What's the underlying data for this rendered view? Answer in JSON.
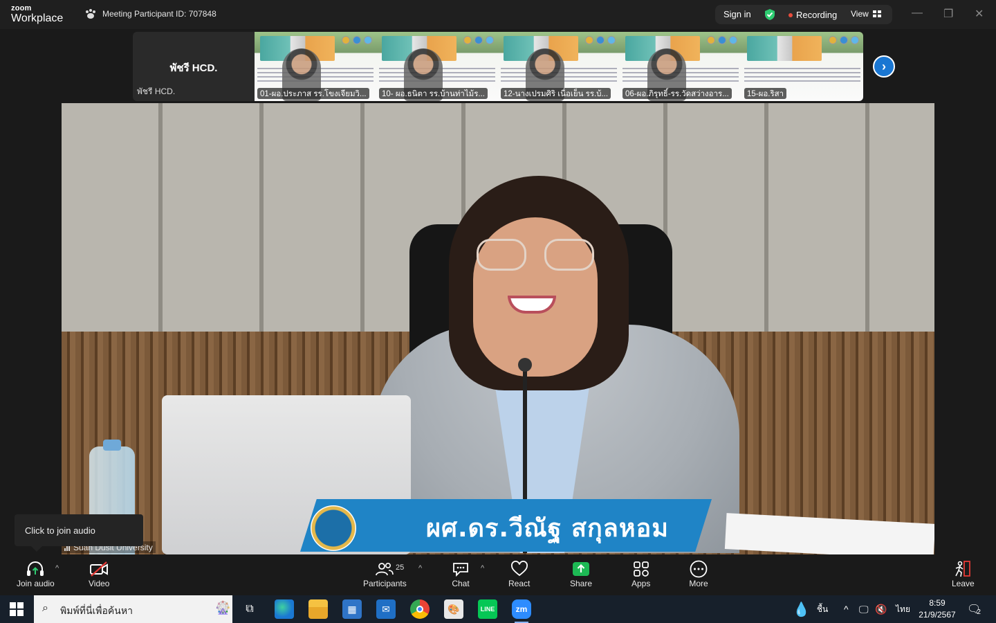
{
  "app": {
    "brand_small": "zoom",
    "brand_large": "Workplace"
  },
  "header": {
    "meeting_id": "Meeting Participant ID: 707848",
    "sign_in": "Sign in",
    "recording": "Recording",
    "view": "View"
  },
  "self_tile": {
    "big_name": "พัชรี HCD.",
    "small_name": "พัชรี HCD."
  },
  "thumbnails": [
    {
      "name": "01-ผอ.ประภาส รร.โขงเจียมวิ...",
      "muted": true
    },
    {
      "name": "10- ผอ.ธนิตา รร.บ้านท่าไม้ร...",
      "muted": true
    },
    {
      "name": "12-นางเปรมศิริ เนื่อเย็น รร.บ้...",
      "muted": true
    },
    {
      "name": "06-ผอ.ภิรุทธิ์-รร.วัดสว่างอาร...",
      "muted": true
    },
    {
      "name": "15-ผอ.ริสา",
      "muted": true
    }
  ],
  "main_video": {
    "name_banner": "ผศ.ดร.วีณัฐ สกุลหอม",
    "label": "Suan Dusit University"
  },
  "tooltip": "Click to join audio",
  "toolbar": {
    "join_audio": "Join audio",
    "video": "Video",
    "participants": "Participants",
    "participants_count": "25",
    "chat": "Chat",
    "react": "React",
    "share": "Share",
    "apps": "Apps",
    "more": "More",
    "leave": "Leave"
  },
  "taskbar": {
    "search_placeholder": "พิมพ์ที่นี่เพื่อค้นหา",
    "weather": "ชื้น",
    "language": "ไทย",
    "time": "8:59",
    "date": "21/9/2567",
    "notifications": "2"
  },
  "colors": {
    "accent_blue": "#1976d2",
    "share_green": "#1db954",
    "recording_red": "#e74c3c",
    "leave_red": "#e53935",
    "banner_blue": "#1f84c6"
  }
}
